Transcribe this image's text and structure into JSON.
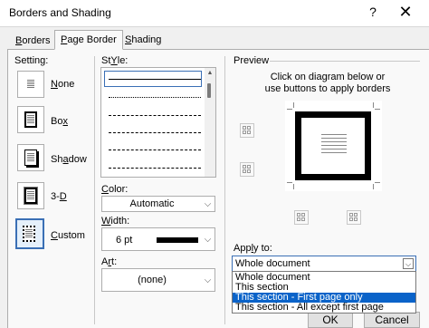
{
  "window": {
    "title": "Borders and Shading",
    "help": "?",
    "close": "✕"
  },
  "tabs": [
    {
      "label": "Borders",
      "u": "B",
      "rest": "orders"
    },
    {
      "label": "Page Border",
      "pre": "",
      "u": "P",
      "rest": "age Border"
    },
    {
      "label": "Shading",
      "u": "S",
      "rest": "hading"
    }
  ],
  "setting": {
    "heading": "Setting:",
    "items": [
      {
        "u": "N",
        "rest": "one"
      },
      {
        "pre": "Bo",
        "u": "x",
        "rest": ""
      },
      {
        "pre": "Sh",
        "u": "a",
        "rest": "dow"
      },
      {
        "pre": "3-",
        "u": "D",
        "rest": ""
      },
      {
        "u": "C",
        "rest": "ustom"
      }
    ]
  },
  "style": {
    "heading_u": "Y",
    "heading_pre": "St",
    "heading_rest": "le:"
  },
  "color": {
    "heading_u": "C",
    "heading_rest": "olor:",
    "value": "Automatic"
  },
  "width": {
    "heading_u": "W",
    "heading_rest": "idth:",
    "value": "6 pt"
  },
  "art": {
    "heading_pre": "A",
    "heading_u": "r",
    "heading_rest": "t:",
    "value": "(none)"
  },
  "preview": {
    "heading": "Preview",
    "line1": "Click on diagram below or",
    "line2": "use buttons to apply borders"
  },
  "apply_to": {
    "heading_pre": "App",
    "heading_u": "l",
    "heading_rest": "y to:",
    "value": "Whole document",
    "options": [
      "Whole document",
      "This section",
      "This section - First page only",
      "This section - All except first page"
    ],
    "selected_index": 2
  },
  "buttons": {
    "ok": "OK",
    "cancel": "Cancel"
  }
}
